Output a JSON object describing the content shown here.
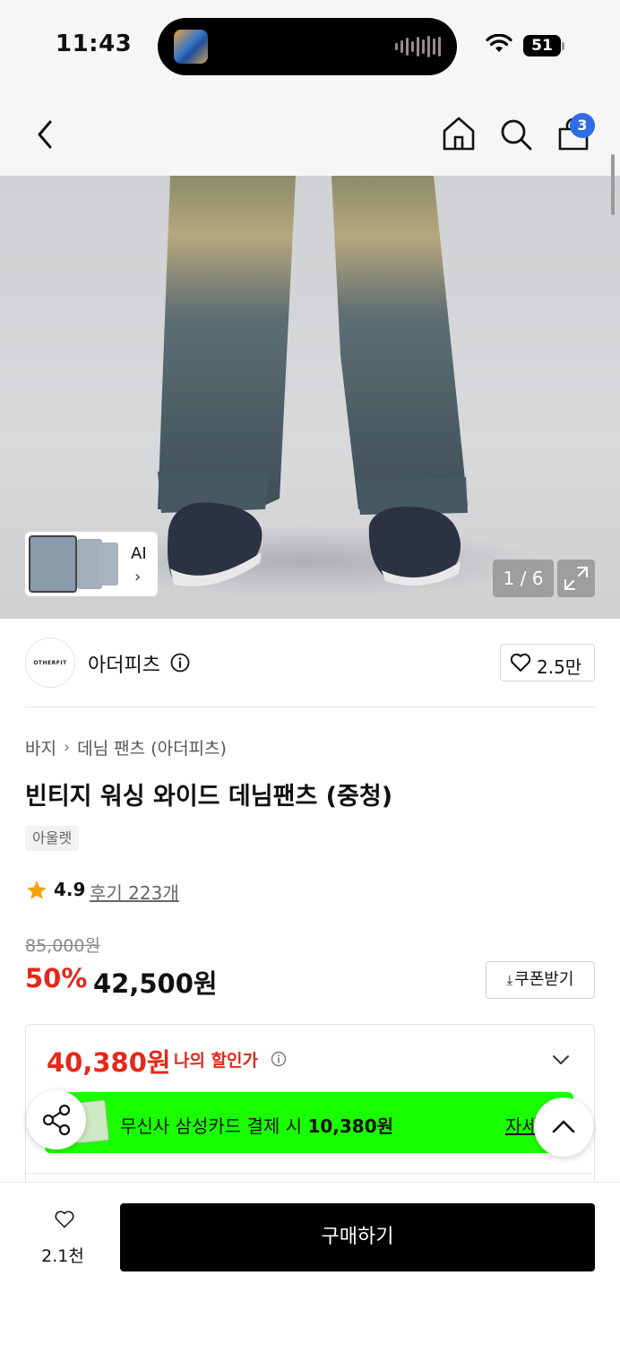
{
  "status_bar": {
    "time": "11:43",
    "battery": "51"
  },
  "nav": {
    "cart_count": "3",
    "icons": [
      "back-icon",
      "home-icon",
      "search-icon",
      "shopping-bag-icon"
    ]
  },
  "gallery": {
    "ai_label": "AI",
    "counter": "1 / 6"
  },
  "brand": {
    "logo_text": "OTHERFIT",
    "name": "아더피츠",
    "likes": "2.5만"
  },
  "breadcrumb": {
    "category": "바지",
    "subcategory": "데님 팬츠 (아더피츠)"
  },
  "product": {
    "title": "빈티지 워싱 와이드 데님팬츠 (중청)",
    "tag": "아울렛",
    "rating": "4.9",
    "reviews": "후기 223개",
    "original_price": "85,000원",
    "discount_rate": "50%",
    "price": "42,500원",
    "coupon_label": "쿠폰받기"
  },
  "my_discount": {
    "price": "40,380원",
    "label": "나의 할인가",
    "banner_text_prefix": "무신사 삼성카드 결제 시 ",
    "banner_amount": "10,380원",
    "banner_link": "자세"
  },
  "bottom": {
    "wish_count": "2.1천",
    "buy_label": "구매하기"
  },
  "colors": {
    "accent_red": "#e5281a",
    "badge_blue": "#2f6de6",
    "banner_green": "#1aff00"
  }
}
